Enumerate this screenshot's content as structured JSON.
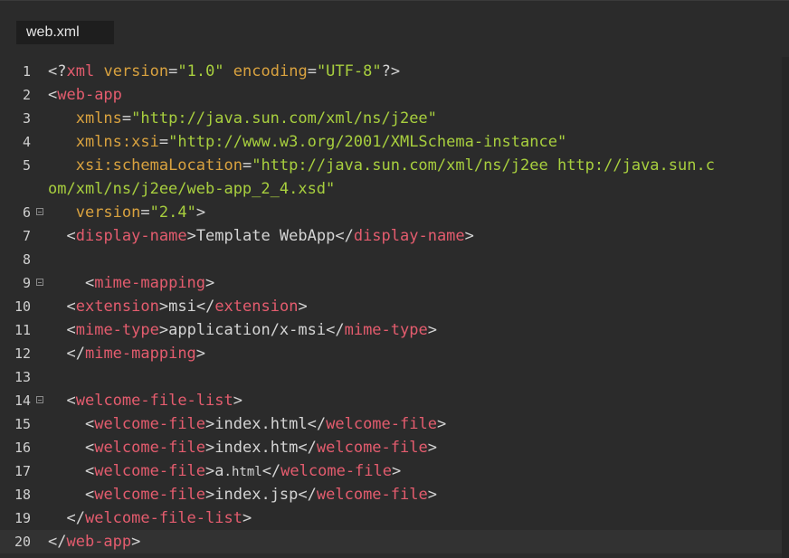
{
  "tab": {
    "label": "web.xml"
  },
  "colors": {
    "background": "#2b2b2b",
    "tag": "#e45c6e",
    "attribute": "#d9a23f",
    "string": "#a8cf3e",
    "text": "#d4d4d4"
  },
  "lines": [
    {
      "num": "1",
      "fold": false,
      "tokens": [
        {
          "t": "punct",
          "v": "<?"
        },
        {
          "t": "tag",
          "v": "xml"
        },
        {
          "t": "text",
          "v": " "
        },
        {
          "t": "attr",
          "v": "version"
        },
        {
          "t": "punct",
          "v": "="
        },
        {
          "t": "str",
          "v": "\"1.0\""
        },
        {
          "t": "text",
          "v": " "
        },
        {
          "t": "attr",
          "v": "encoding"
        },
        {
          "t": "punct",
          "v": "="
        },
        {
          "t": "str",
          "v": "\"UTF-8\""
        },
        {
          "t": "punct",
          "v": "?>"
        }
      ]
    },
    {
      "num": "2",
      "fold": false,
      "tokens": [
        {
          "t": "punct",
          "v": "<"
        },
        {
          "t": "tag",
          "v": "web-app"
        }
      ]
    },
    {
      "num": "3",
      "fold": false,
      "tokens": [
        {
          "t": "text",
          "v": "   "
        },
        {
          "t": "attr",
          "v": "xmlns"
        },
        {
          "t": "punct",
          "v": "="
        },
        {
          "t": "str",
          "v": "\"http://java.sun.com/xml/ns/j2ee\""
        }
      ]
    },
    {
      "num": "4",
      "fold": false,
      "tokens": [
        {
          "t": "text",
          "v": "   "
        },
        {
          "t": "attr",
          "v": "xmlns:xsi"
        },
        {
          "t": "punct",
          "v": "="
        },
        {
          "t": "str",
          "v": "\"http://www.w3.org/2001/XMLSchema-instance\""
        }
      ]
    },
    {
      "num": "5",
      "fold": false,
      "tokens": [
        {
          "t": "text",
          "v": "   "
        },
        {
          "t": "attr",
          "v": "xsi:schemaLocation"
        },
        {
          "t": "punct",
          "v": "="
        },
        {
          "t": "str",
          "v": "\"http://java.sun.com/xml/ns/j2ee http://java.sun.c"
        }
      ]
    },
    {
      "num": "",
      "fold": false,
      "tokens": [
        {
          "t": "str",
          "v": "om/xml/ns/j2ee/web-app_2_4.xsd\""
        }
      ]
    },
    {
      "num": "6",
      "fold": true,
      "tokens": [
        {
          "t": "text",
          "v": "   "
        },
        {
          "t": "attr",
          "v": "version"
        },
        {
          "t": "punct",
          "v": "="
        },
        {
          "t": "str",
          "v": "\"2.4\""
        },
        {
          "t": "punct",
          "v": ">"
        }
      ]
    },
    {
      "num": "7",
      "fold": false,
      "tokens": [
        {
          "t": "text",
          "v": "  "
        },
        {
          "t": "punct",
          "v": "<"
        },
        {
          "t": "tag",
          "v": "display-name"
        },
        {
          "t": "punct",
          "v": ">"
        },
        {
          "t": "text",
          "v": "Template WebApp"
        },
        {
          "t": "punct",
          "v": "</"
        },
        {
          "t": "tag",
          "v": "display-name"
        },
        {
          "t": "punct",
          "v": ">"
        }
      ]
    },
    {
      "num": "8",
      "fold": false,
      "tokens": []
    },
    {
      "num": "9",
      "fold": true,
      "tokens": [
        {
          "t": "text",
          "v": "    "
        },
        {
          "t": "punct",
          "v": "<"
        },
        {
          "t": "tag",
          "v": "mime-mapping"
        },
        {
          "t": "punct",
          "v": ">"
        }
      ]
    },
    {
      "num": "10",
      "fold": false,
      "tokens": [
        {
          "t": "text",
          "v": "  "
        },
        {
          "t": "punct",
          "v": "<"
        },
        {
          "t": "tag",
          "v": "extension"
        },
        {
          "t": "punct",
          "v": ">"
        },
        {
          "t": "text",
          "v": "msi"
        },
        {
          "t": "punct",
          "v": "</"
        },
        {
          "t": "tag",
          "v": "extension"
        },
        {
          "t": "punct",
          "v": ">"
        }
      ]
    },
    {
      "num": "11",
      "fold": false,
      "tokens": [
        {
          "t": "text",
          "v": "  "
        },
        {
          "t": "punct",
          "v": "<"
        },
        {
          "t": "tag",
          "v": "mime-type"
        },
        {
          "t": "punct",
          "v": ">"
        },
        {
          "t": "text",
          "v": "application/x-msi"
        },
        {
          "t": "punct",
          "v": "</"
        },
        {
          "t": "tag",
          "v": "mime-type"
        },
        {
          "t": "punct",
          "v": ">"
        }
      ]
    },
    {
      "num": "12",
      "fold": false,
      "tokens": [
        {
          "t": "text",
          "v": "  "
        },
        {
          "t": "punct",
          "v": "</"
        },
        {
          "t": "tag",
          "v": "mime-mapping"
        },
        {
          "t": "punct",
          "v": ">"
        }
      ]
    },
    {
      "num": "13",
      "fold": false,
      "tokens": []
    },
    {
      "num": "14",
      "fold": true,
      "tokens": [
        {
          "t": "text",
          "v": "  "
        },
        {
          "t": "punct",
          "v": "<"
        },
        {
          "t": "tag",
          "v": "welcome-file-list"
        },
        {
          "t": "punct",
          "v": ">"
        }
      ]
    },
    {
      "num": "15",
      "fold": false,
      "tokens": [
        {
          "t": "text",
          "v": "    "
        },
        {
          "t": "punct",
          "v": "<"
        },
        {
          "t": "tag",
          "v": "welcome-file"
        },
        {
          "t": "punct",
          "v": ">"
        },
        {
          "t": "text",
          "v": "index.html"
        },
        {
          "t": "punct",
          "v": "</"
        },
        {
          "t": "tag",
          "v": "welcome-file"
        },
        {
          "t": "punct",
          "v": ">"
        }
      ]
    },
    {
      "num": "16",
      "fold": false,
      "tokens": [
        {
          "t": "text",
          "v": "    "
        },
        {
          "t": "punct",
          "v": "<"
        },
        {
          "t": "tag",
          "v": "welcome-file"
        },
        {
          "t": "punct",
          "v": ">"
        },
        {
          "t": "text",
          "v": "index.htm"
        },
        {
          "t": "punct",
          "v": "</"
        },
        {
          "t": "tag",
          "v": "welcome-file"
        },
        {
          "t": "punct",
          "v": ">"
        }
      ]
    },
    {
      "num": "17",
      "fold": false,
      "tokens": [
        {
          "t": "text",
          "v": "    "
        },
        {
          "t": "punct",
          "v": "<"
        },
        {
          "t": "tag",
          "v": "welcome-file"
        },
        {
          "t": "punct",
          "v": ">"
        },
        {
          "t": "text",
          "v": "a"
        },
        {
          "t": "small",
          "v": ".html"
        },
        {
          "t": "punct",
          "v": "</"
        },
        {
          "t": "tag",
          "v": "welcome-file"
        },
        {
          "t": "punct",
          "v": ">"
        }
      ]
    },
    {
      "num": "18",
      "fold": false,
      "tokens": [
        {
          "t": "text",
          "v": "    "
        },
        {
          "t": "punct",
          "v": "<"
        },
        {
          "t": "tag",
          "v": "welcome-file"
        },
        {
          "t": "punct",
          "v": ">"
        },
        {
          "t": "text",
          "v": "index.jsp"
        },
        {
          "t": "punct",
          "v": "</"
        },
        {
          "t": "tag",
          "v": "welcome-file"
        },
        {
          "t": "punct",
          "v": ">"
        }
      ]
    },
    {
      "num": "19",
      "fold": false,
      "tokens": [
        {
          "t": "text",
          "v": "  "
        },
        {
          "t": "punct",
          "v": "</"
        },
        {
          "t": "tag",
          "v": "welcome-file-list"
        },
        {
          "t": "punct",
          "v": ">"
        }
      ]
    },
    {
      "num": "20",
      "fold": false,
      "current": true,
      "tokens": [
        {
          "t": "punct",
          "v": "</"
        },
        {
          "t": "tag",
          "v": "web-app"
        },
        {
          "t": "punct",
          "v": ">"
        }
      ]
    }
  ]
}
